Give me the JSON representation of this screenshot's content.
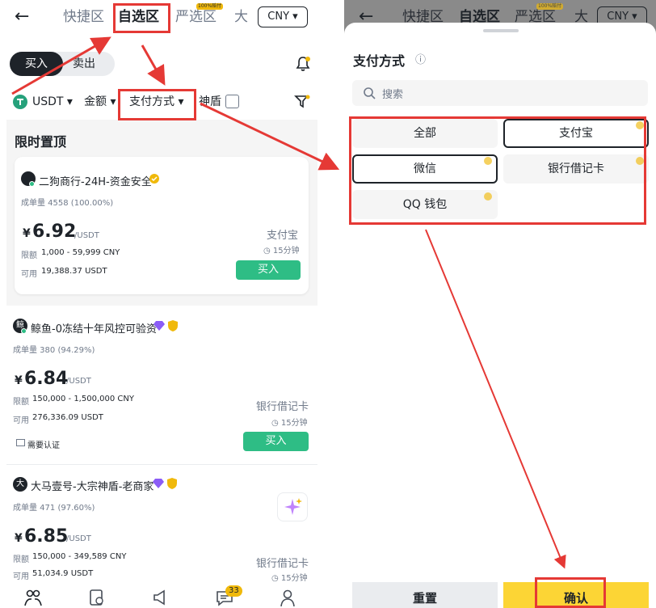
{
  "left": {
    "header": {
      "back": "←",
      "tabs": [
        "快捷区",
        "自选区",
        "严选区",
        "大"
      ],
      "badge": "100%赔付",
      "currency": "CNY ▾"
    },
    "toggle": {
      "buy": "买入",
      "sell": "卖出"
    },
    "filters": {
      "coin": "USDT ▾",
      "amount": "金额 ▾",
      "payment": "支付方式 ▾",
      "shield": "神盾"
    },
    "pinned_title": "限时置顶",
    "offers": [
      {
        "merchant": "二狗商行-24H-资金安全",
        "orders_label": "成单量 4558 (100.00%)",
        "currency_sym": "¥",
        "price": "6.92",
        "unit": "/USDT",
        "limit_label": "限额",
        "limit": "1,000 - 59,999 CNY",
        "avail_label": "可用",
        "avail": "19,388.37 USDT",
        "method": "支付宝",
        "time": "◷ 15分钟",
        "action": "买入"
      },
      {
        "avatar": "鲸",
        "merchant": "鲸鱼-0冻结十年风控可验资",
        "orders_label": "成单量 380 (94.29%)",
        "currency_sym": "¥",
        "price": "6.84",
        "unit": "/USDT",
        "limit_label": "限额",
        "limit": "150,000 - 1,500,000 CNY",
        "avail_label": "可用",
        "avail": "276,336.09 USDT",
        "method": "银行借记卡",
        "time": "◷ 15分钟",
        "verify": "需要认证",
        "action": "买入"
      },
      {
        "avatar": "大",
        "merchant": "大马壹号-大宗神盾-老商家",
        "orders_label": "成单量 471 (97.60%)",
        "currency_sym": "¥",
        "price": "6.85",
        "unit": "/USDT",
        "limit_label": "限额",
        "limit": "150,000 - 349,589 CNY",
        "avail_label": "可用",
        "avail": "51,034.9 USDT",
        "method": "银行借记卡",
        "time": "◷ 15分钟"
      }
    ],
    "nav_badge": "33"
  },
  "right": {
    "header": {
      "back": "←",
      "tabs": [
        "快捷区",
        "自选区",
        "严选区",
        "大"
      ],
      "badge": "100%赔付",
      "currency": "CNY ▾"
    },
    "sheet_title": "支付方式",
    "info": "ⓘ",
    "search_placeholder": "搜索",
    "options": [
      "全部",
      "支付宝",
      "微信",
      "银行借记卡",
      "QQ 钱包"
    ],
    "reset": "重置",
    "confirm": "确认"
  },
  "colors": {
    "accent": "#f0b90b",
    "buy_green": "#2ebd85",
    "annotation_red": "#e53935"
  }
}
